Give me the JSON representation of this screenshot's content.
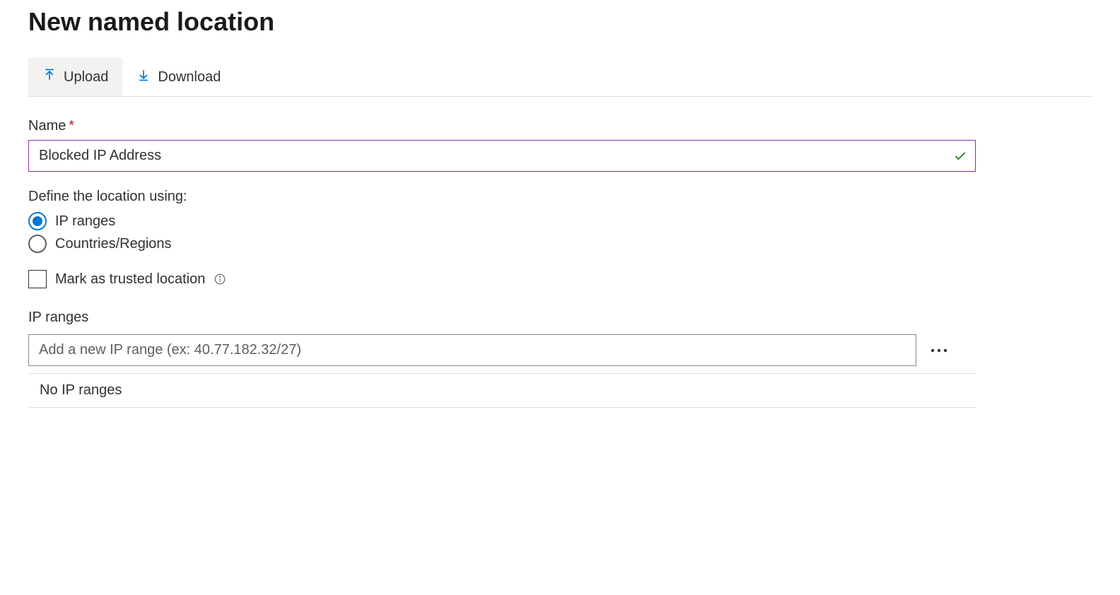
{
  "page": {
    "title": "New named location"
  },
  "toolbar": {
    "upload_label": "Upload",
    "download_label": "Download"
  },
  "form": {
    "name_label": "Name",
    "name_value": "Blocked IP Address",
    "define_label": "Define the location using:",
    "radio_ip_label": "IP ranges",
    "radio_countries_label": "Countries/Regions",
    "trusted_label": "Mark as trusted location",
    "ip_section_label": "IP ranges",
    "ip_placeholder": "Add a new IP range (ex: 40.77.182.32/27)",
    "empty_text": "No IP ranges"
  }
}
